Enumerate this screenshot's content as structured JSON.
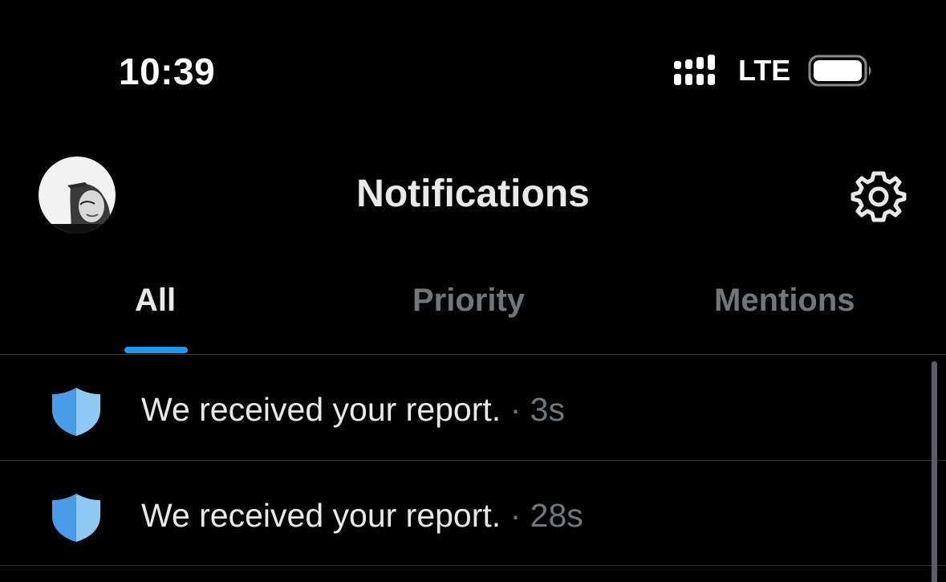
{
  "status_bar": {
    "time": "10:39",
    "network": "LTE",
    "icons": [
      "signal-icon",
      "battery-icon"
    ]
  },
  "header": {
    "title": "Notifications",
    "avatar_icon": "avatar",
    "settings_icon": "gear-icon"
  },
  "tabs": [
    {
      "label": "All",
      "active": true
    },
    {
      "label": "Priority",
      "active": false
    },
    {
      "label": "Mentions",
      "active": false
    }
  ],
  "notifications": [
    {
      "icon": "shield-icon",
      "text": "We received your report.",
      "time": "3s"
    },
    {
      "icon": "shield-icon",
      "text": "We received your report.",
      "time": "28s"
    }
  ],
  "colors": {
    "background": "#000000",
    "accent": "#1d9bf0",
    "text_primary": "#e7e9ea",
    "text_secondary": "#71767b"
  }
}
